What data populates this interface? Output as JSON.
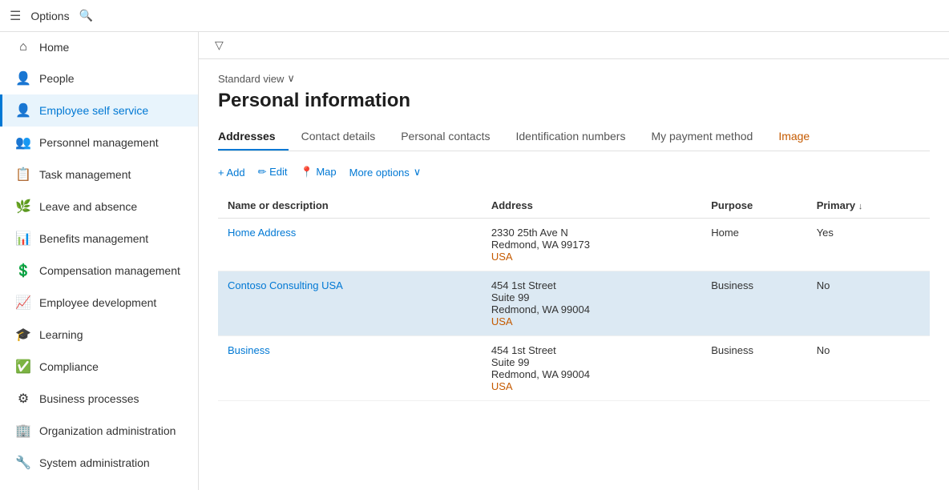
{
  "topbar": {
    "menu_icon": "☰",
    "options_label": "Options",
    "search_icon": "🔍"
  },
  "sidebar": {
    "items": [
      {
        "id": "home",
        "icon": "⌂",
        "label": "Home",
        "active": false
      },
      {
        "id": "people",
        "icon": "👤",
        "label": "People",
        "active": false
      },
      {
        "id": "employee-self-service",
        "icon": "👤",
        "label": "Employee self service",
        "active": true
      },
      {
        "id": "personnel-management",
        "icon": "👥",
        "label": "Personnel management",
        "active": false
      },
      {
        "id": "task-management",
        "icon": "📋",
        "label": "Task management",
        "active": false
      },
      {
        "id": "leave-and-absence",
        "icon": "🌿",
        "label": "Leave and absence",
        "active": false
      },
      {
        "id": "benefits-management",
        "icon": "📊",
        "label": "Benefits management",
        "active": false
      },
      {
        "id": "compensation-management",
        "icon": "💰",
        "label": "Compensation management",
        "active": false
      },
      {
        "id": "employee-development",
        "icon": "📈",
        "label": "Employee development",
        "active": false
      },
      {
        "id": "learning",
        "icon": "🎓",
        "label": "Learning",
        "active": false
      },
      {
        "id": "compliance",
        "icon": "✅",
        "label": "Compliance",
        "active": false
      },
      {
        "id": "business-processes",
        "icon": "⚙",
        "label": "Business processes",
        "active": false
      },
      {
        "id": "organization-administration",
        "icon": "🏢",
        "label": "Organization administration",
        "active": false
      },
      {
        "id": "system-administration",
        "icon": "🔧",
        "label": "System administration",
        "active": false
      }
    ]
  },
  "content": {
    "filter_icon": "▽",
    "standard_view_label": "Standard view",
    "chevron_down": "∨",
    "page_title": "Personal information",
    "tabs": [
      {
        "id": "addresses",
        "label": "Addresses",
        "active": true,
        "orange": false
      },
      {
        "id": "contact-details",
        "label": "Contact details",
        "active": false,
        "orange": false
      },
      {
        "id": "personal-contacts",
        "label": "Personal contacts",
        "active": false,
        "orange": false
      },
      {
        "id": "identification-numbers",
        "label": "Identification numbers",
        "active": false,
        "orange": false
      },
      {
        "id": "my-payment-method",
        "label": "My payment method",
        "active": false,
        "orange": false
      },
      {
        "id": "image",
        "label": "Image",
        "active": false,
        "orange": true
      }
    ],
    "toolbar": {
      "add_label": "+ Add",
      "edit_label": "✏ Edit",
      "map_label": "📍 Map",
      "more_options_label": "More options",
      "chevron": "∨"
    },
    "table": {
      "columns": [
        {
          "id": "name",
          "label": "Name or description"
        },
        {
          "id": "address",
          "label": "Address"
        },
        {
          "id": "purpose",
          "label": "Purpose"
        },
        {
          "id": "primary",
          "label": "Primary",
          "sortable": true,
          "sort_icon": "↓"
        }
      ],
      "rows": [
        {
          "id": "row1",
          "name": "Home Address",
          "name_link": true,
          "address_lines": [
            "2330 25th Ave N",
            "Redmond, WA 99173",
            "USA"
          ],
          "address_link_index": 2,
          "purpose": "Home",
          "primary": "Yes",
          "highlighted": false
        },
        {
          "id": "row2",
          "name": "Contoso Consulting USA",
          "name_link": true,
          "address_lines": [
            "454 1st Street",
            "Suite 99",
            "Redmond, WA 99004",
            "USA"
          ],
          "address_link_index": 3,
          "purpose": "Business",
          "primary": "No",
          "highlighted": true
        },
        {
          "id": "row3",
          "name": "Business",
          "name_link": true,
          "address_lines": [
            "454 1st Street",
            "Suite 99",
            "Redmond, WA 99004",
            "USA"
          ],
          "address_link_index": 3,
          "purpose": "Business",
          "primary": "No",
          "highlighted": false
        }
      ]
    }
  }
}
